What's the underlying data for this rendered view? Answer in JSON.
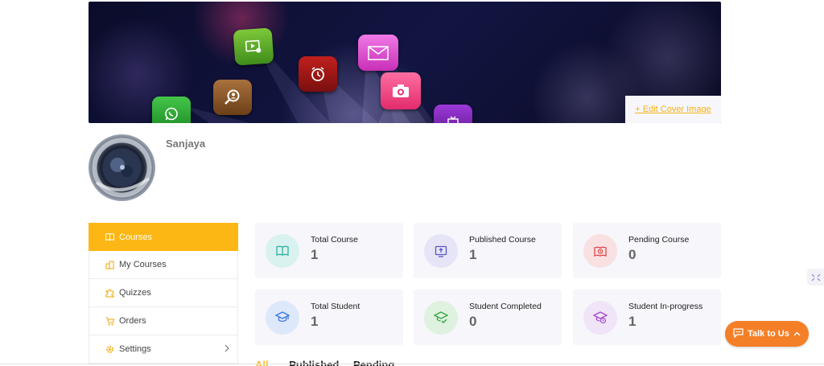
{
  "cover": {
    "edit_label": "+ Edit Cover Image",
    "app_icons": [
      "video-play-icon",
      "alarm-clock-icon",
      "mail-icon",
      "camera-icon",
      "magnifier-person-icon",
      "whatsapp-icon",
      "tv-icon"
    ]
  },
  "profile": {
    "name": "Sanjaya"
  },
  "sidebar": {
    "items": [
      {
        "label": "Courses",
        "icon": "book-icon",
        "active": true
      },
      {
        "label": "My Courses",
        "icon": "my-courses-icon",
        "active": false
      },
      {
        "label": "Quizzes",
        "icon": "puzzle-icon",
        "active": false
      },
      {
        "label": "Orders",
        "icon": "cart-icon",
        "active": false
      },
      {
        "label": "Settings",
        "icon": "gear-icon",
        "active": false,
        "has_submenu": true
      }
    ]
  },
  "stats": [
    {
      "label": "Total Course",
      "value": "1",
      "icon": "book-icon",
      "color": "#d9f2ef",
      "icon_color": "#2bb0a0"
    },
    {
      "label": "Published Course",
      "value": "1",
      "icon": "publish-icon",
      "color": "#e6e5f7",
      "icon_color": "#5b54c7"
    },
    {
      "label": "Pending Course",
      "value": "0",
      "icon": "pending-icon",
      "color": "#f9e1e1",
      "icon_color": "#e0474c"
    },
    {
      "label": "Total Student",
      "value": "1",
      "icon": "graduate-icon",
      "color": "#dde9fb",
      "icon_color": "#3b74e3"
    },
    {
      "label": "Student Completed",
      "value": "0",
      "icon": "completed-icon",
      "color": "#dff2df",
      "icon_color": "#3aa346"
    },
    {
      "label": "Student In-progress",
      "value": "1",
      "icon": "progress-icon",
      "color": "#f0e4f8",
      "icon_color": "#a24ccd"
    }
  ],
  "tabs": {
    "all": "All",
    "published": "Published",
    "pending": "Pending"
  },
  "chat": {
    "label": "Talk to Us"
  },
  "colors": {
    "accent": "#fdb714",
    "talk_button": "#f47f27"
  }
}
